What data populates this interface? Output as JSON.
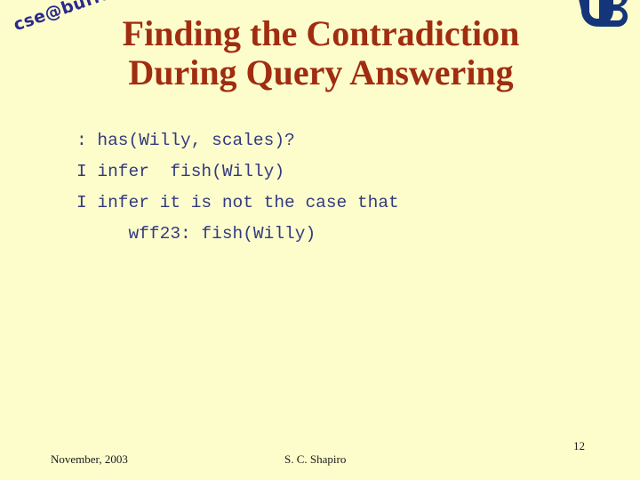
{
  "slide": {
    "background_color": "#fdfdcc",
    "title_color": "#a02d10",
    "body_color": "#333a80",
    "logo_color": "#2a2a8c",
    "footer_color": "#1a1a1a"
  },
  "branding": {
    "cse_wordmark": "cse@buffalo",
    "ub_monogram_alt": "UB"
  },
  "title": {
    "line1": "Finding the Contradiction",
    "line2": "During Query Answering"
  },
  "body": {
    "lines": [
      ": has(Willy, scales)?",
      "I infer  fish(Willy)",
      "I infer it is not the case that",
      "     wff23: fish(Willy)"
    ]
  },
  "footer": {
    "date": "November, 2003",
    "author": "S. C. Shapiro",
    "page_number": "12"
  }
}
